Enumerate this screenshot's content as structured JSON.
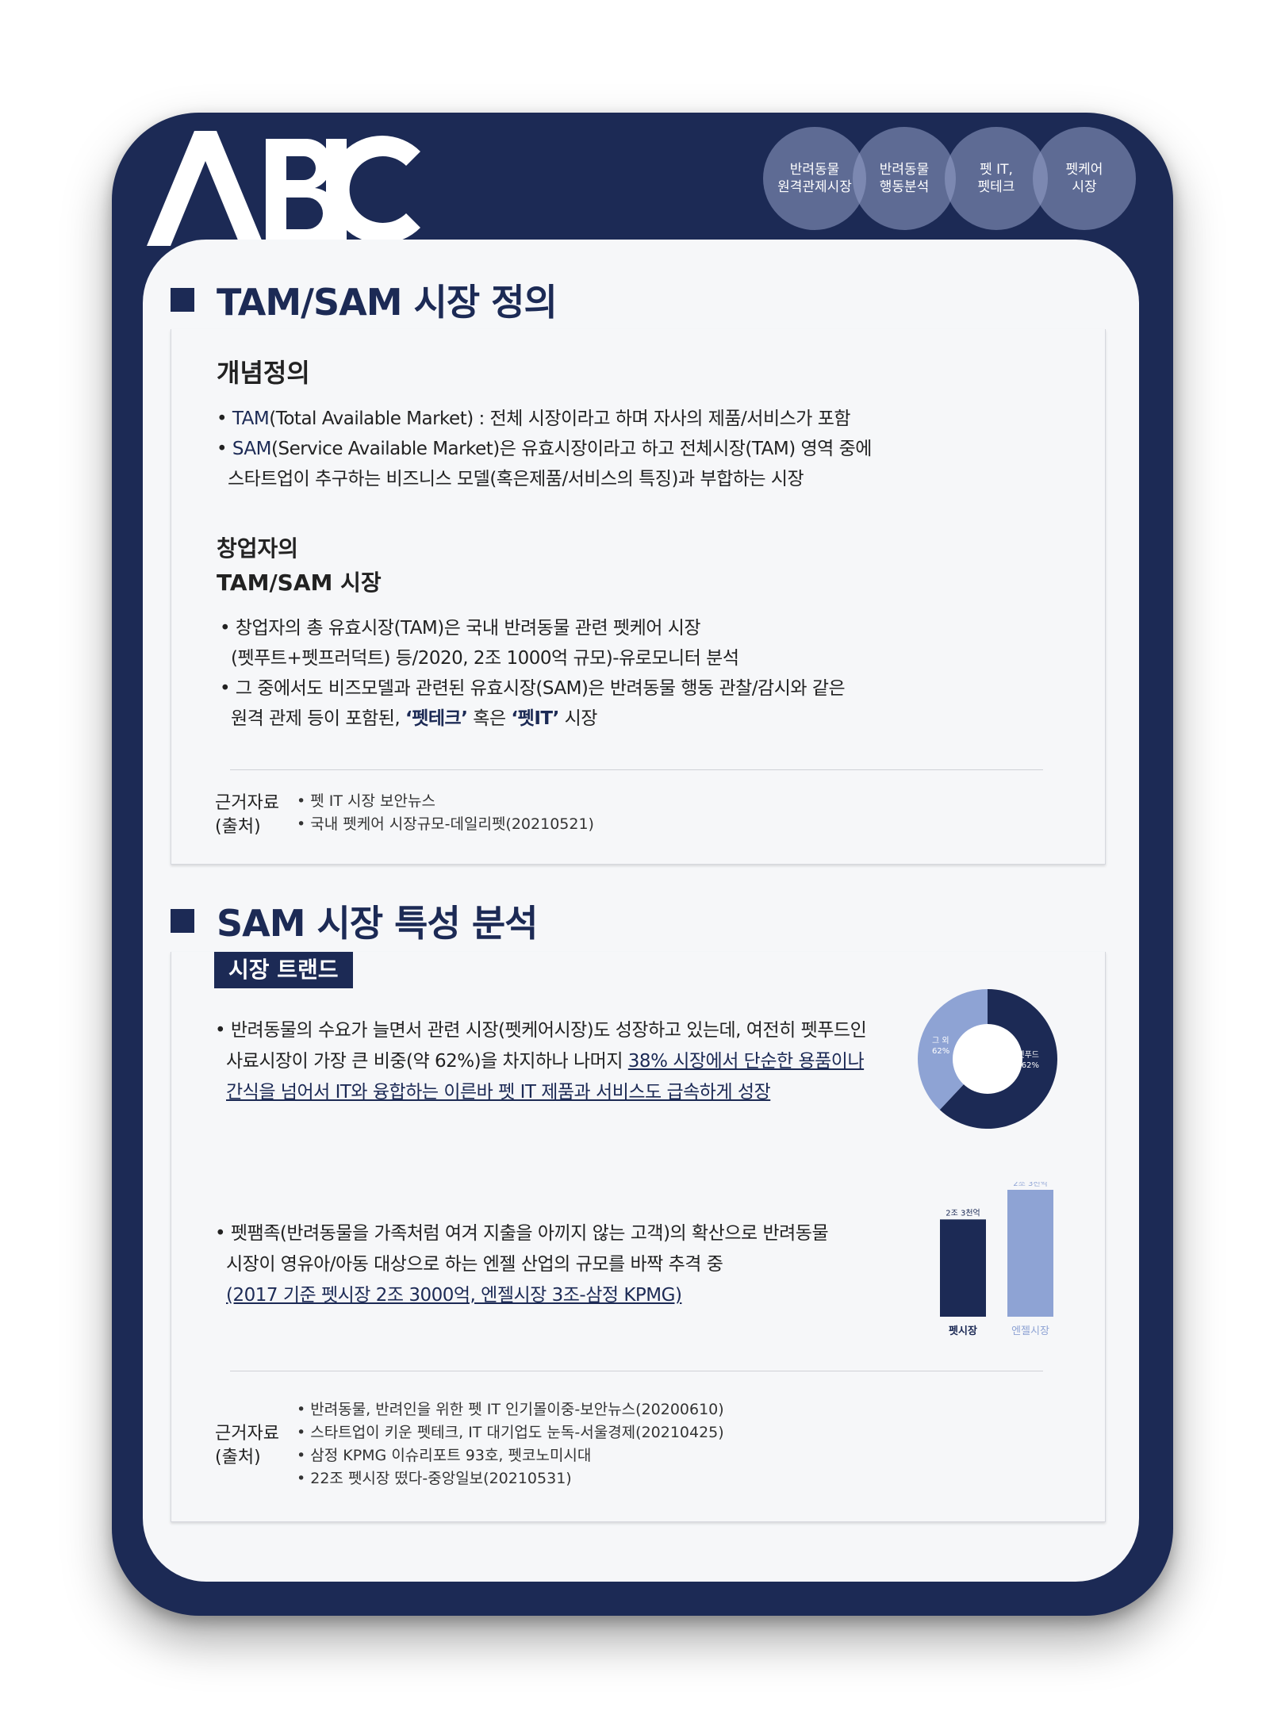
{
  "logo": "ABIC",
  "nav_pills": [
    {
      "label": "반려동물\n원격관제시장"
    },
    {
      "label": "반려동물\n행동분석"
    },
    {
      "label": "펫 IT,\n펫테크"
    },
    {
      "label": "펫케어\n시장"
    }
  ],
  "section1": {
    "title": "TAM/SAM 시장 정의",
    "concept_heading": "개념정의",
    "tam_term": "TAM",
    "tam_text": "(Total Available Market) : 전체 시장이라고 하며 자사의 제품/서비스가 포함",
    "sam_term": "SAM",
    "sam_text_1": "(Service Available Market)은 유효시장이라고 하고 전체시장(TAM) 영역 중에",
    "sam_text_2": "스타트업이 추구하는 비즈니스 모델(혹은제품/서비스의 특징)과 부합하는 시장",
    "founder_heading_1": "창업자의",
    "founder_heading_2": "TAM/SAM 시장",
    "founder_b1_1": "창업자의 총 유효시장(TAM)은 국내 반려동물 관련 펫케어 시장",
    "founder_b1_2": "(펫푸트+펫프러덕트) 등/2020, 2조 1000억 규모)-유로모니터 분석",
    "founder_b2_1": "그 중에서도 비즈모델과 관련된 유효시장(SAM)은 반려동물 행동 관찰/감시와 같은",
    "founder_b2_2a": "원격 관제 등이 포함된, ",
    "founder_b2_2b": "‘펫테크’",
    "founder_b2_2c": " 혹은 ",
    "founder_b2_2d": "‘펫IT’",
    "founder_b2_2e": " 시장",
    "source_label": "근거자료\n(출처)",
    "sources": [
      "펫 IT 시장 보안뉴스",
      "국내 펫케어 시장규모-데일리펫(20210521)"
    ]
  },
  "section2": {
    "title": "SAM 시장 특성 분석",
    "tag": "시장 트랜드",
    "p1_l1": "반려동물의 수요가 늘면서 관련 시장(펫케어시장)도 성장하고 있는데, 여전히 펫푸드인",
    "p1_l2a": "사료시장이 가장 큰 비중(약 62%)을 차지하나 나머지 ",
    "p1_l2b": "38% 시장에서 단순한 용품이나",
    "p1_l3": "간식을 넘어서  IT와 융합하는 이른바 펫 IT 제품과 서비스도 급속하게 성장",
    "p2_l1": "펫팸족(반려동물을 가족처럼 여겨 지출을 아끼지 않는 고객)의 확산으로 반려동물",
    "p2_l2": "시장이 영유아/아동 대상으로 하는 엔젤 산업의 규모를 바짝 추격 중",
    "p2_l3": "(2017 기준 펫시장 2조 3000억, 엔젤시장 3조-삼정 KPMG)",
    "source_label": "근거자료\n(출처)",
    "sources": [
      "반려동물, 반려인을 위한 펫 IT 인기몰이중-보안뉴스(20200610)",
      "스타트업이 키운 펫테크, IT 대기업도 눈독-서울경제(20210425)",
      "삼정 KPMG 이슈리포트 93호, 펫코노미시대",
      "22조 펫시장 떴다-중앙일보(20210531)"
    ]
  },
  "chart_data": [
    {
      "type": "pie",
      "categories": [
        "펫푸드",
        "그 외"
      ],
      "values": [
        62,
        38
      ],
      "labels": [
        "펫푸드\n62%",
        "그 외\n62%"
      ],
      "colors": [
        "#1c2a55",
        "#8ea3d4"
      ]
    },
    {
      "type": "bar",
      "categories": [
        "펫시장",
        "엔젤시장"
      ],
      "values": [
        2.3,
        3.0
      ],
      "data_labels": [
        "2조 3천억",
        "2조 3천억"
      ],
      "colors": [
        "#1c2a55",
        "#8ea3d4"
      ]
    }
  ]
}
